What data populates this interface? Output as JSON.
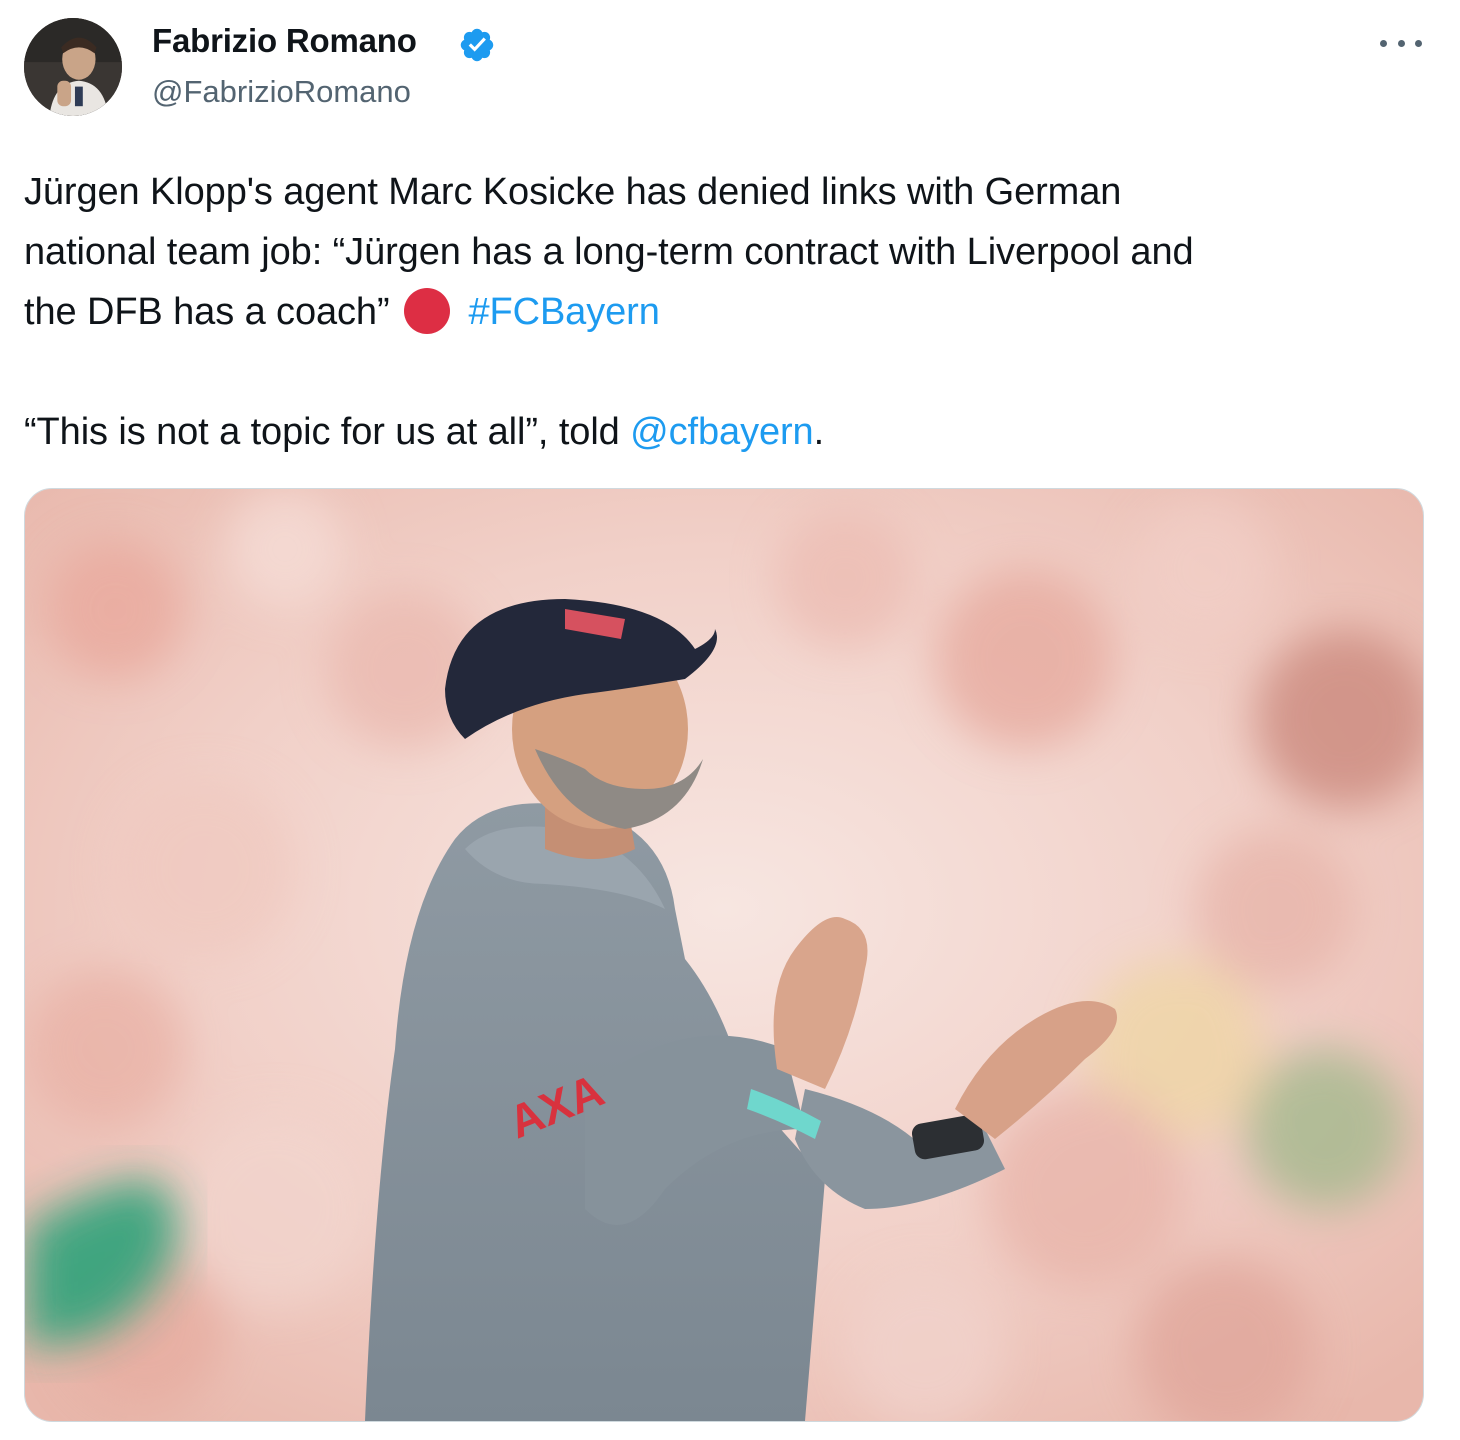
{
  "author": {
    "display_name": "Fabrizio Romano",
    "handle": "@FabrizioRomano",
    "verified": true
  },
  "tweet": {
    "line1_text": "Jürgen Klopp's agent Marc Kosicke has denied links with German",
    "line2_text": "national team job: “Jürgen has a long-term contract with Liverpool and",
    "line3_text": "the DFB has a coach”",
    "hashtag": "#FCBayern",
    "line4_prefix": "“This is not a topic for us at all”, told ",
    "mention": "@cfbayern",
    "line4_suffix": "."
  },
  "media": {
    "sleeve_logo": "AXA"
  },
  "colors": {
    "link": "#1d9bf0",
    "verified_badge": "#1d9bf0",
    "red_circle_emoji": "#dd2e44",
    "secondary_text": "#536471"
  },
  "icons": {
    "verified": "verified-badge-icon",
    "more": "more-options-icon",
    "emoji": "red-circle-icon"
  }
}
